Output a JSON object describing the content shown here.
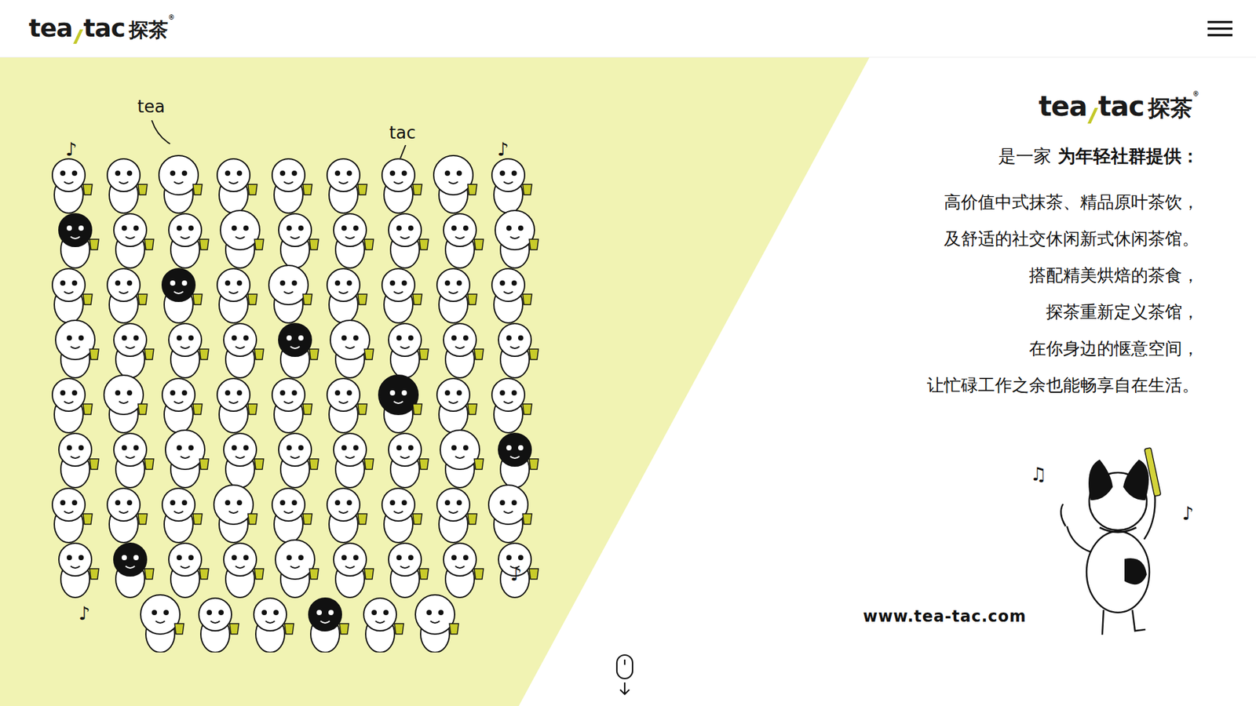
{
  "header": {
    "logo": {
      "left": "tea",
      "right": "tac",
      "cn": "探茶",
      "mark": "®"
    }
  },
  "illustration": {
    "labels": [
      "tea",
      "tac"
    ]
  },
  "intro": {
    "logo": {
      "left": "tea",
      "right": "tac",
      "cn": "探茶",
      "mark": "®"
    },
    "lead_plain": "是一家",
    "lead_bold": "为年轻社群提供：",
    "lines": [
      "高价值中式抹茶、精品原叶茶饮，",
      "及舒适的社交休闲新式休闲茶馆。",
      "搭配精美烘焙的茶食，",
      "探茶重新定义茶馆，",
      "在你身边的惬意空间，",
      "让忙碌工作之余也能畅享自在生活。"
    ],
    "website": "www.tea-tac.com"
  }
}
